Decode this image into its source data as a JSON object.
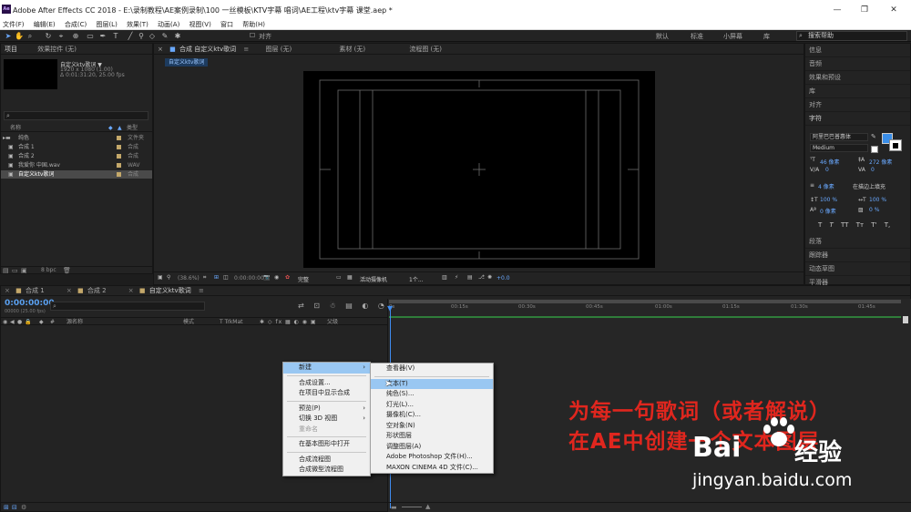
{
  "window": {
    "title": "Adobe After Effects CC 2018 - E:\\录制教程\\AE案例录制\\100 一丝模板\\KTV字幕 唱词\\AE工程\\ktv字幕 课堂.aep *",
    "app_badge": "Ae",
    "minimize": "—",
    "maximize": "❐",
    "close": "✕"
  },
  "menubar": [
    "文件(F)",
    "编辑(E)",
    "合成(C)",
    "图层(L)",
    "效果(T)",
    "动画(A)",
    "视图(V)",
    "窗口",
    "帮助(H)"
  ],
  "toolbar": {
    "snap_label": "对齐",
    "workspaces": [
      "默认",
      "标准",
      "小屏幕",
      "库"
    ],
    "search_placeholder": "搜索帮助"
  },
  "project_panel": {
    "tabs": [
      "项目",
      "效果控件 (无)"
    ],
    "selected_name": "自定义ktv歌词 ▼",
    "selected_info1": "1920 x 1080 (1.00)",
    "selected_info2": "Δ 0:01:31:20, 25.00 fps",
    "columns": {
      "name": "名称",
      "type": "类型"
    },
    "items": [
      {
        "name": "纯色",
        "type": "文件夹",
        "color": "#c4a86a"
      },
      {
        "name": "合成 1",
        "type": "合成",
        "color": "#c4a86a"
      },
      {
        "name": "合成 2",
        "type": "合成",
        "color": "#c4a86a"
      },
      {
        "name": "我爱你 中国.wav",
        "type": "WAV",
        "color": "#c4a86a"
      },
      {
        "name": "自定义ktv歌词",
        "type": "合成",
        "color": "#c4a86a"
      }
    ],
    "bpc": "8 bpc"
  },
  "viewer": {
    "tabs": [
      "合成 自定义ktv歌词",
      "图层 (无)",
      "素材 (无)",
      "流程图 (无)"
    ],
    "comp_chip": "自定义ktv歌词",
    "zoom": "(38.6%)",
    "timecode": "0:00:00:00",
    "quality": "完整",
    "camera": "活动摄像机",
    "views": "1个...",
    "exposure": "+0.0"
  },
  "right_panels": {
    "items": [
      "信息",
      "音频",
      "效果和预设",
      "库",
      "对齐"
    ],
    "character": {
      "title": "字符",
      "font": "阿里巴巴普惠体",
      "style": "Medium",
      "size": "46 像素",
      "leading": "272 像素",
      "kerning": "0",
      "tracking": "0",
      "stroke": "4 像素",
      "stroke_mode": "在描边上填充",
      "vscale": "100 %",
      "hscale": "100 %",
      "baseline": "0 像素",
      "tsume": "0 %",
      "styles": [
        "T",
        "T",
        "TT",
        "Tт",
        "T'",
        "T,"
      ]
    },
    "bottom_items": [
      "段落",
      "跟踪器",
      "动态草图",
      "平滑器"
    ]
  },
  "timeline": {
    "tabs": [
      "合成 1",
      "合成 2",
      "自定义ktv歌词"
    ],
    "timecode": "0:00:00:00",
    "timecode_sub": "00000 (25.00 fps)",
    "columns": {
      "layer": "源名称",
      "mode": "模式",
      "trkmat": "T TrkMat",
      "parent": "父级"
    },
    "ruler": [
      "0s",
      "00:15s",
      "00:30s",
      "00:45s",
      "01:00s",
      "01:15s",
      "01:30s",
      "01:45s"
    ]
  },
  "context_menu": {
    "items": [
      {
        "label": "新建",
        "arrow": "›",
        "highlight": true
      },
      {
        "sep": true
      },
      {
        "label": "合成设置..."
      },
      {
        "label": "在项目中显示合成"
      },
      {
        "sep": true
      },
      {
        "label": "预览(P)",
        "arrow": "›"
      },
      {
        "label": "切换 3D 视图",
        "arrow": "›"
      },
      {
        "label": "重命名",
        "disabled": true
      },
      {
        "sep": true
      },
      {
        "label": "在基本图形中打开"
      },
      {
        "sep": true
      },
      {
        "label": "合成流程图"
      },
      {
        "label": "合成微型流程图"
      }
    ]
  },
  "submenu": {
    "items": [
      {
        "label": "查看器(V)"
      },
      {
        "sep": true
      },
      {
        "label": "文本(T)",
        "highlight": true
      },
      {
        "label": "纯色(S)..."
      },
      {
        "label": "灯光(L)..."
      },
      {
        "label": "摄像机(C)..."
      },
      {
        "label": "空对象(N)"
      },
      {
        "label": "形状图层"
      },
      {
        "label": "调整图层(A)"
      },
      {
        "label": "Adobe Photoshop 文件(H)..."
      },
      {
        "label": "MAXON CINEMA 4D 文件(C)..."
      }
    ]
  },
  "overlay": {
    "line1": "为每一句歌词（或者解说）",
    "line2": "在AE中创建一个文本图层",
    "color": "#e0261e"
  },
  "watermark": {
    "brand": "Bai",
    "brand2": "经验",
    "url": "jingyan.baidu.com"
  }
}
